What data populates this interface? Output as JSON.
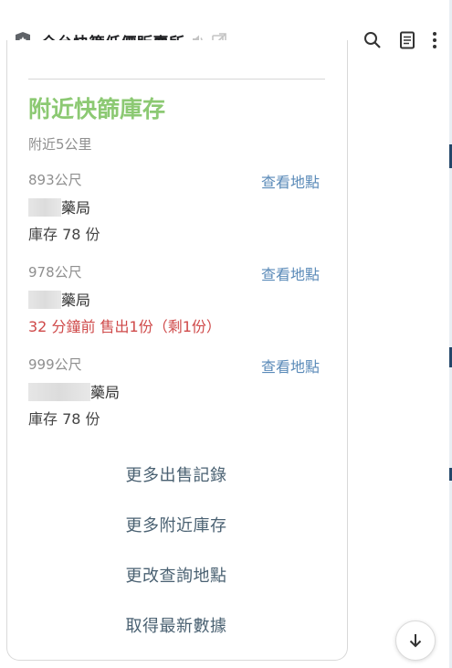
{
  "header": {
    "title": "全台快篩低價販賣所",
    "icons": [
      "shield-icon",
      "speaker-icon",
      "external-link-icon",
      "search-icon",
      "reader-icon",
      "more-icon"
    ]
  },
  "section": {
    "title": "附近快篩庫存",
    "radius": "附近5公里",
    "view_link": "查看地點"
  },
  "stores": [
    {
      "distance": "893公尺",
      "name_suffix": "藥局",
      "status": "庫存 78 份",
      "status_type": "stock"
    },
    {
      "distance": "978公尺",
      "name_suffix": "藥局",
      "status": "32 分鐘前 售出1份（剩1份）",
      "status_type": "sold"
    },
    {
      "distance": "999公尺",
      "name_suffix": "藥局",
      "status": "庫存 78 份",
      "status_type": "stock"
    }
  ],
  "actions": {
    "more_sales": "更多出售記錄",
    "more_stock": "更多附近庫存",
    "change_location": "更改查詢地點",
    "refresh": "取得最新數據"
  },
  "colors": {
    "accent_green": "#8cc973",
    "link_blue": "#5a8ab8",
    "alert_red": "#cf4949"
  }
}
